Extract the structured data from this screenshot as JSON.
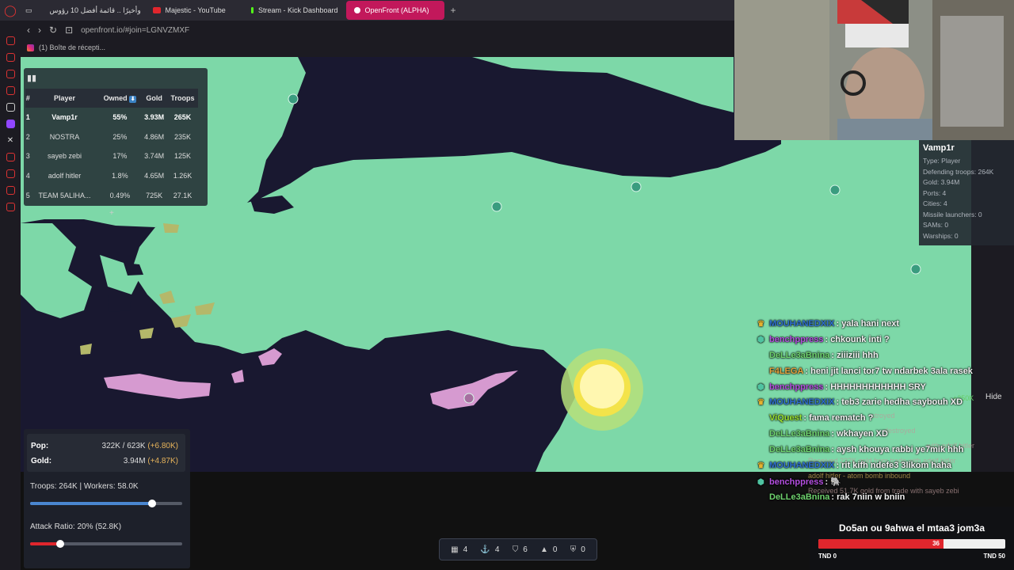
{
  "browser": {
    "tabs": [
      {
        "label": "وأخيرًا .. قائمة أفضل 10 رؤوس",
        "active": false,
        "color": "#e0262d"
      },
      {
        "label": "Majestic - YouTube",
        "active": false,
        "color": "#e0262d"
      },
      {
        "label": "Stream - Kick Dashboard",
        "active": false,
        "color": "#53fc18"
      },
      {
        "label": "OpenFront (ALPHA)",
        "active": true,
        "color": "#ffffff"
      }
    ],
    "new_tab": "+",
    "url": "openfront.io/#join=LGNVZMXF",
    "bookmark": "(1) Boîte de récepti..."
  },
  "leaderboard": {
    "headers": [
      "#",
      "Player",
      "Owned",
      "Gold",
      "Troops"
    ],
    "rows": [
      {
        "rank": "1",
        "player": "Vamp1r",
        "owned": "55%",
        "gold": "3.93M",
        "troops": "265K"
      },
      {
        "rank": "2",
        "player": "NOSTRA",
        "owned": "25%",
        "gold": "4.86M",
        "troops": "235K"
      },
      {
        "rank": "3",
        "player": "sayeb zebi",
        "owned": "17%",
        "gold": "3.74M",
        "troops": "125K"
      },
      {
        "rank": "4",
        "player": "adolf hitler",
        "owned": "1.8%",
        "gold": "4.65M",
        "troops": "1.26K"
      },
      {
        "rank": "5",
        "player": "TEAM 5ALIHA...",
        "owned": "0.49%",
        "gold": "725K",
        "troops": "27.1K"
      }
    ],
    "expand": "+"
  },
  "stats": {
    "pop_label": "Pop:",
    "pop_value": "322K / 623K",
    "pop_delta": "(+6.80K)",
    "gold_label": "Gold:",
    "gold_value": "3.94M",
    "gold_delta": "(+4.87K)",
    "troops_text": "Troops: 264K | Workers: 58.0K",
    "troops_ratio": 0.8,
    "attack_text": "Attack Ratio: 20% (52.8K)",
    "attack_ratio": 0.2
  },
  "counters": [
    {
      "icon": "city-icon",
      "glyph": "▦",
      "value": "4"
    },
    {
      "icon": "port-icon",
      "glyph": "⚓",
      "value": "4"
    },
    {
      "icon": "defense-post-icon",
      "glyph": "⛉",
      "value": "6"
    },
    {
      "icon": "missile-silo-icon",
      "glyph": "▲",
      "value": "0"
    },
    {
      "icon": "sam-icon",
      "glyph": "⛨",
      "value": "0"
    }
  ],
  "player_info": {
    "name": "Vamp1r",
    "lines": [
      "Type: Player",
      "Defending troops: 264K",
      "Gold: 3.94M",
      "Ports: 4",
      "Cities: 4",
      "Missile launchers: 0",
      "SAMs: 0",
      "Warships: 0"
    ]
  },
  "chat": [
    {
      "badge": "♛",
      "badge_color": "#e6b22e",
      "user": "MOUHANEDXIX",
      "user_color": "#2f6fd0",
      "text": ": yala hani next"
    },
    {
      "badge": "⬢",
      "badge_color": "#4fc3a1",
      "user": "benchppress",
      "user_color": "#b44fe0",
      "text": ": chkounk inti ?"
    },
    {
      "badge": "",
      "badge_color": "#fff",
      "user": "DeLLe3aBnina",
      "user_color": "#6fd36f",
      "text": ": ziiiziii hhh"
    },
    {
      "badge": "",
      "badge_color": "#fff",
      "user": "F4LEGA",
      "user_color": "#e6a23c",
      "text": ": heni jit lanci tor7 tw ndarbek 3ala rasek"
    },
    {
      "badge": "⬢",
      "badge_color": "#4fc3a1",
      "user": "benchppress",
      "user_color": "#b44fe0",
      "text": ": HHHHHHHHHHHH SRY"
    },
    {
      "badge": "♛",
      "badge_color": "#e6b22e",
      "user": "MOUHANEDXIX",
      "user_color": "#2f6fd0",
      "text": ": teb3 zarie hedha saybouh XD"
    },
    {
      "badge": "",
      "badge_color": "#fff",
      "user": "ViQuest",
      "user_color": "#9ae02f",
      "text": ": fama rematch ?"
    },
    {
      "badge": "",
      "badge_color": "#fff",
      "user": "DeLLe3aBnina",
      "user_color": "#6fd36f",
      "text": ": wkhayen XD"
    },
    {
      "badge": "",
      "badge_color": "#fff",
      "user": "DeLLe3aBnina",
      "user_color": "#6fd36f",
      "text": ": aysh khouya rabbi ye7mik hhh"
    },
    {
      "badge": "♛",
      "badge_color": "#e6b22e",
      "user": "MOUHANEDXIX",
      "user_color": "#2f6fd0",
      "text": ": rit kifh ndefe3 3likom haha"
    },
    {
      "badge": "⬢",
      "badge_color": "#4fc3a1",
      "user": "benchppress",
      "user_color": "#b44fe0",
      "text": ": 🐘"
    },
    {
      "badge": "",
      "badge_color": "#fff",
      "user": "DeLLe3aBnina",
      "user_color": "#6fd36f",
      "text": ": rak 7niin w bniin"
    }
  ],
  "event_log": {
    "gain": "+250K",
    "hide": "Hide",
    "lines": [
      "stroyed",
      "destroyed",
      "with adolf hitler",
      "Received 232K gold from trade with adolf hitler",
      "adolf hitler - atom bomb inbound",
      "Received 51.7K gold from trade with sayeb zebi"
    ]
  },
  "poll": {
    "question": "Do5an ou 9ahwa el mtaa3 jom3a",
    "value": "36",
    "share": 0.67,
    "left": "TND 0",
    "right": "TND 50"
  },
  "colors": {
    "land": "#7dd8a8",
    "water": "#191830",
    "enemy_pink": "#d69ad0",
    "enemy_olive": "#b4b86a",
    "accent_red": "#e0262d",
    "slider_blue": "#4a86d0"
  }
}
